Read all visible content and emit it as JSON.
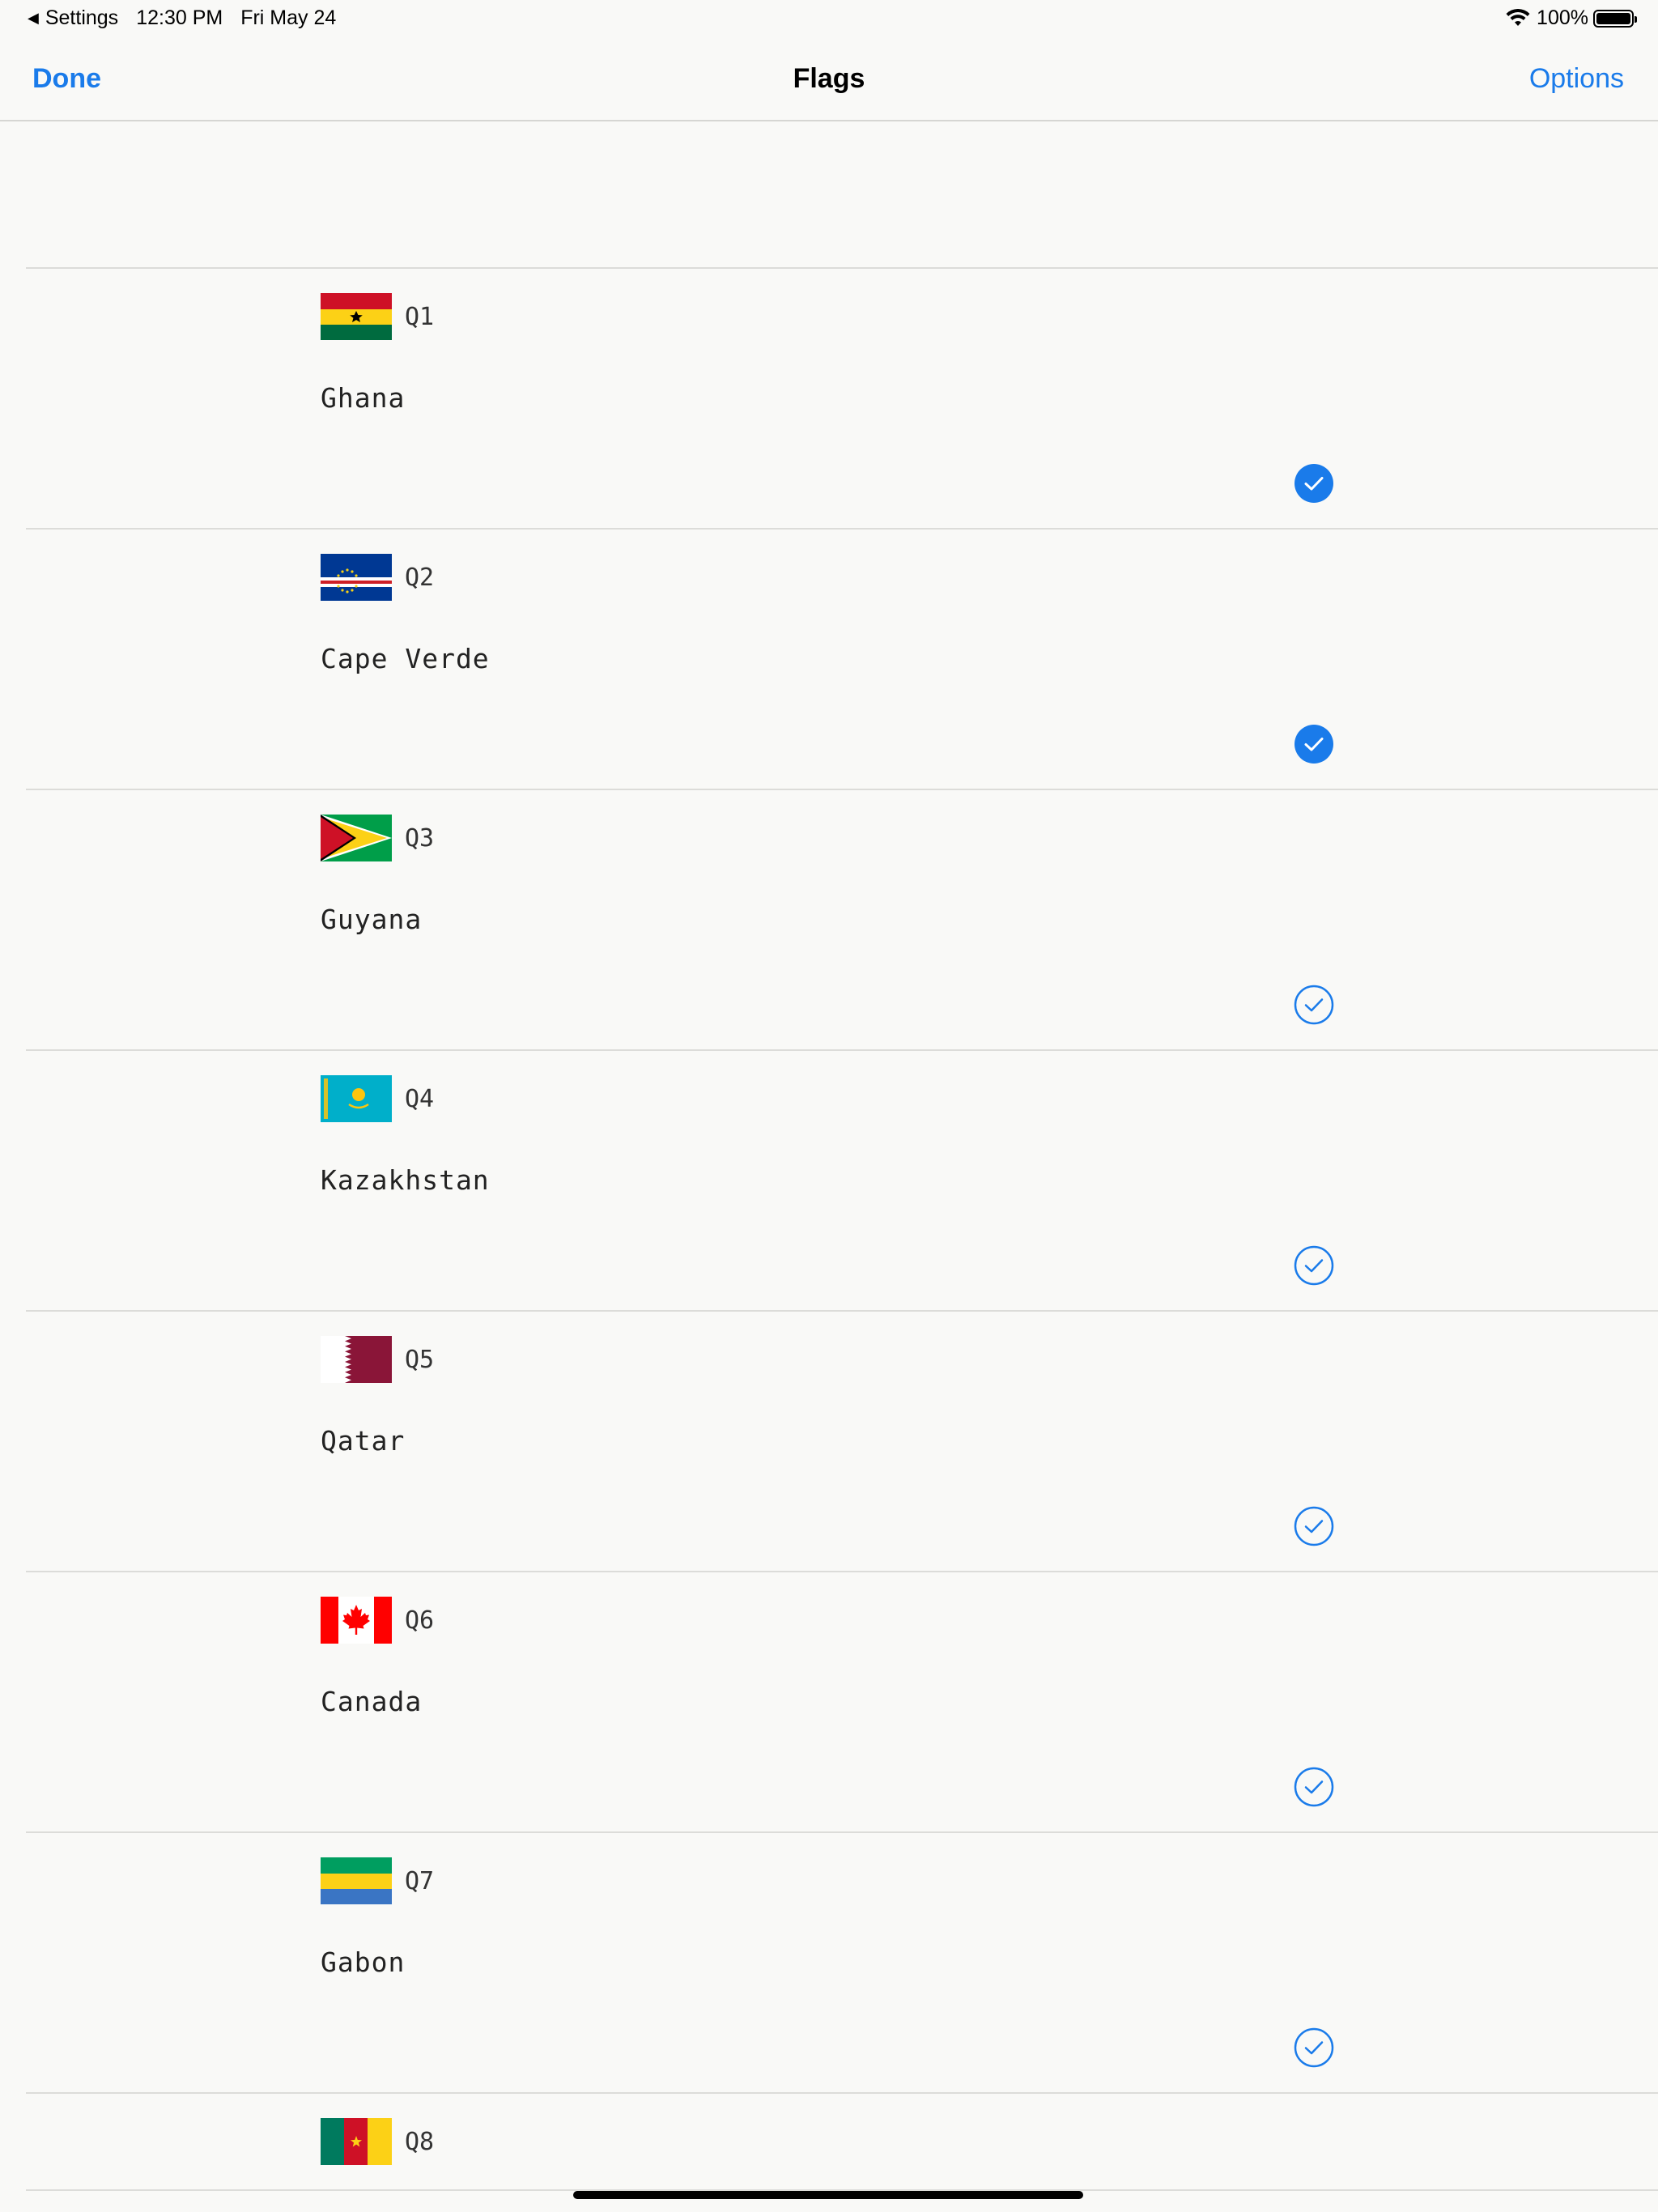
{
  "status_bar": {
    "back_app": "Settings",
    "time": "12:30 PM",
    "date": "Fri May 24",
    "battery": "100%"
  },
  "nav": {
    "done_label": "Done",
    "title": "Flags",
    "options_label": "Options"
  },
  "items": [
    {
      "q": "Q1",
      "name": "Ghana",
      "flag": "ghana-flag",
      "checked": true
    },
    {
      "q": "Q2",
      "name": "Cape Verde",
      "flag": "cape-verde-flag",
      "checked": true
    },
    {
      "q": "Q3",
      "name": "Guyana",
      "flag": "guyana-flag",
      "checked": false
    },
    {
      "q": "Q4",
      "name": "Kazakhstan",
      "flag": "kazakhstan-flag",
      "checked": false
    },
    {
      "q": "Q5",
      "name": "Qatar",
      "flag": "qatar-flag",
      "checked": false
    },
    {
      "q": "Q6",
      "name": "Canada",
      "flag": "canada-flag",
      "checked": false
    },
    {
      "q": "Q7",
      "name": "Gabon",
      "flag": "gabon-flag",
      "checked": false
    },
    {
      "q": "Q8",
      "flag": "cameroon-flag"
    }
  ],
  "colors": {
    "accent": "#1a7bea"
  }
}
